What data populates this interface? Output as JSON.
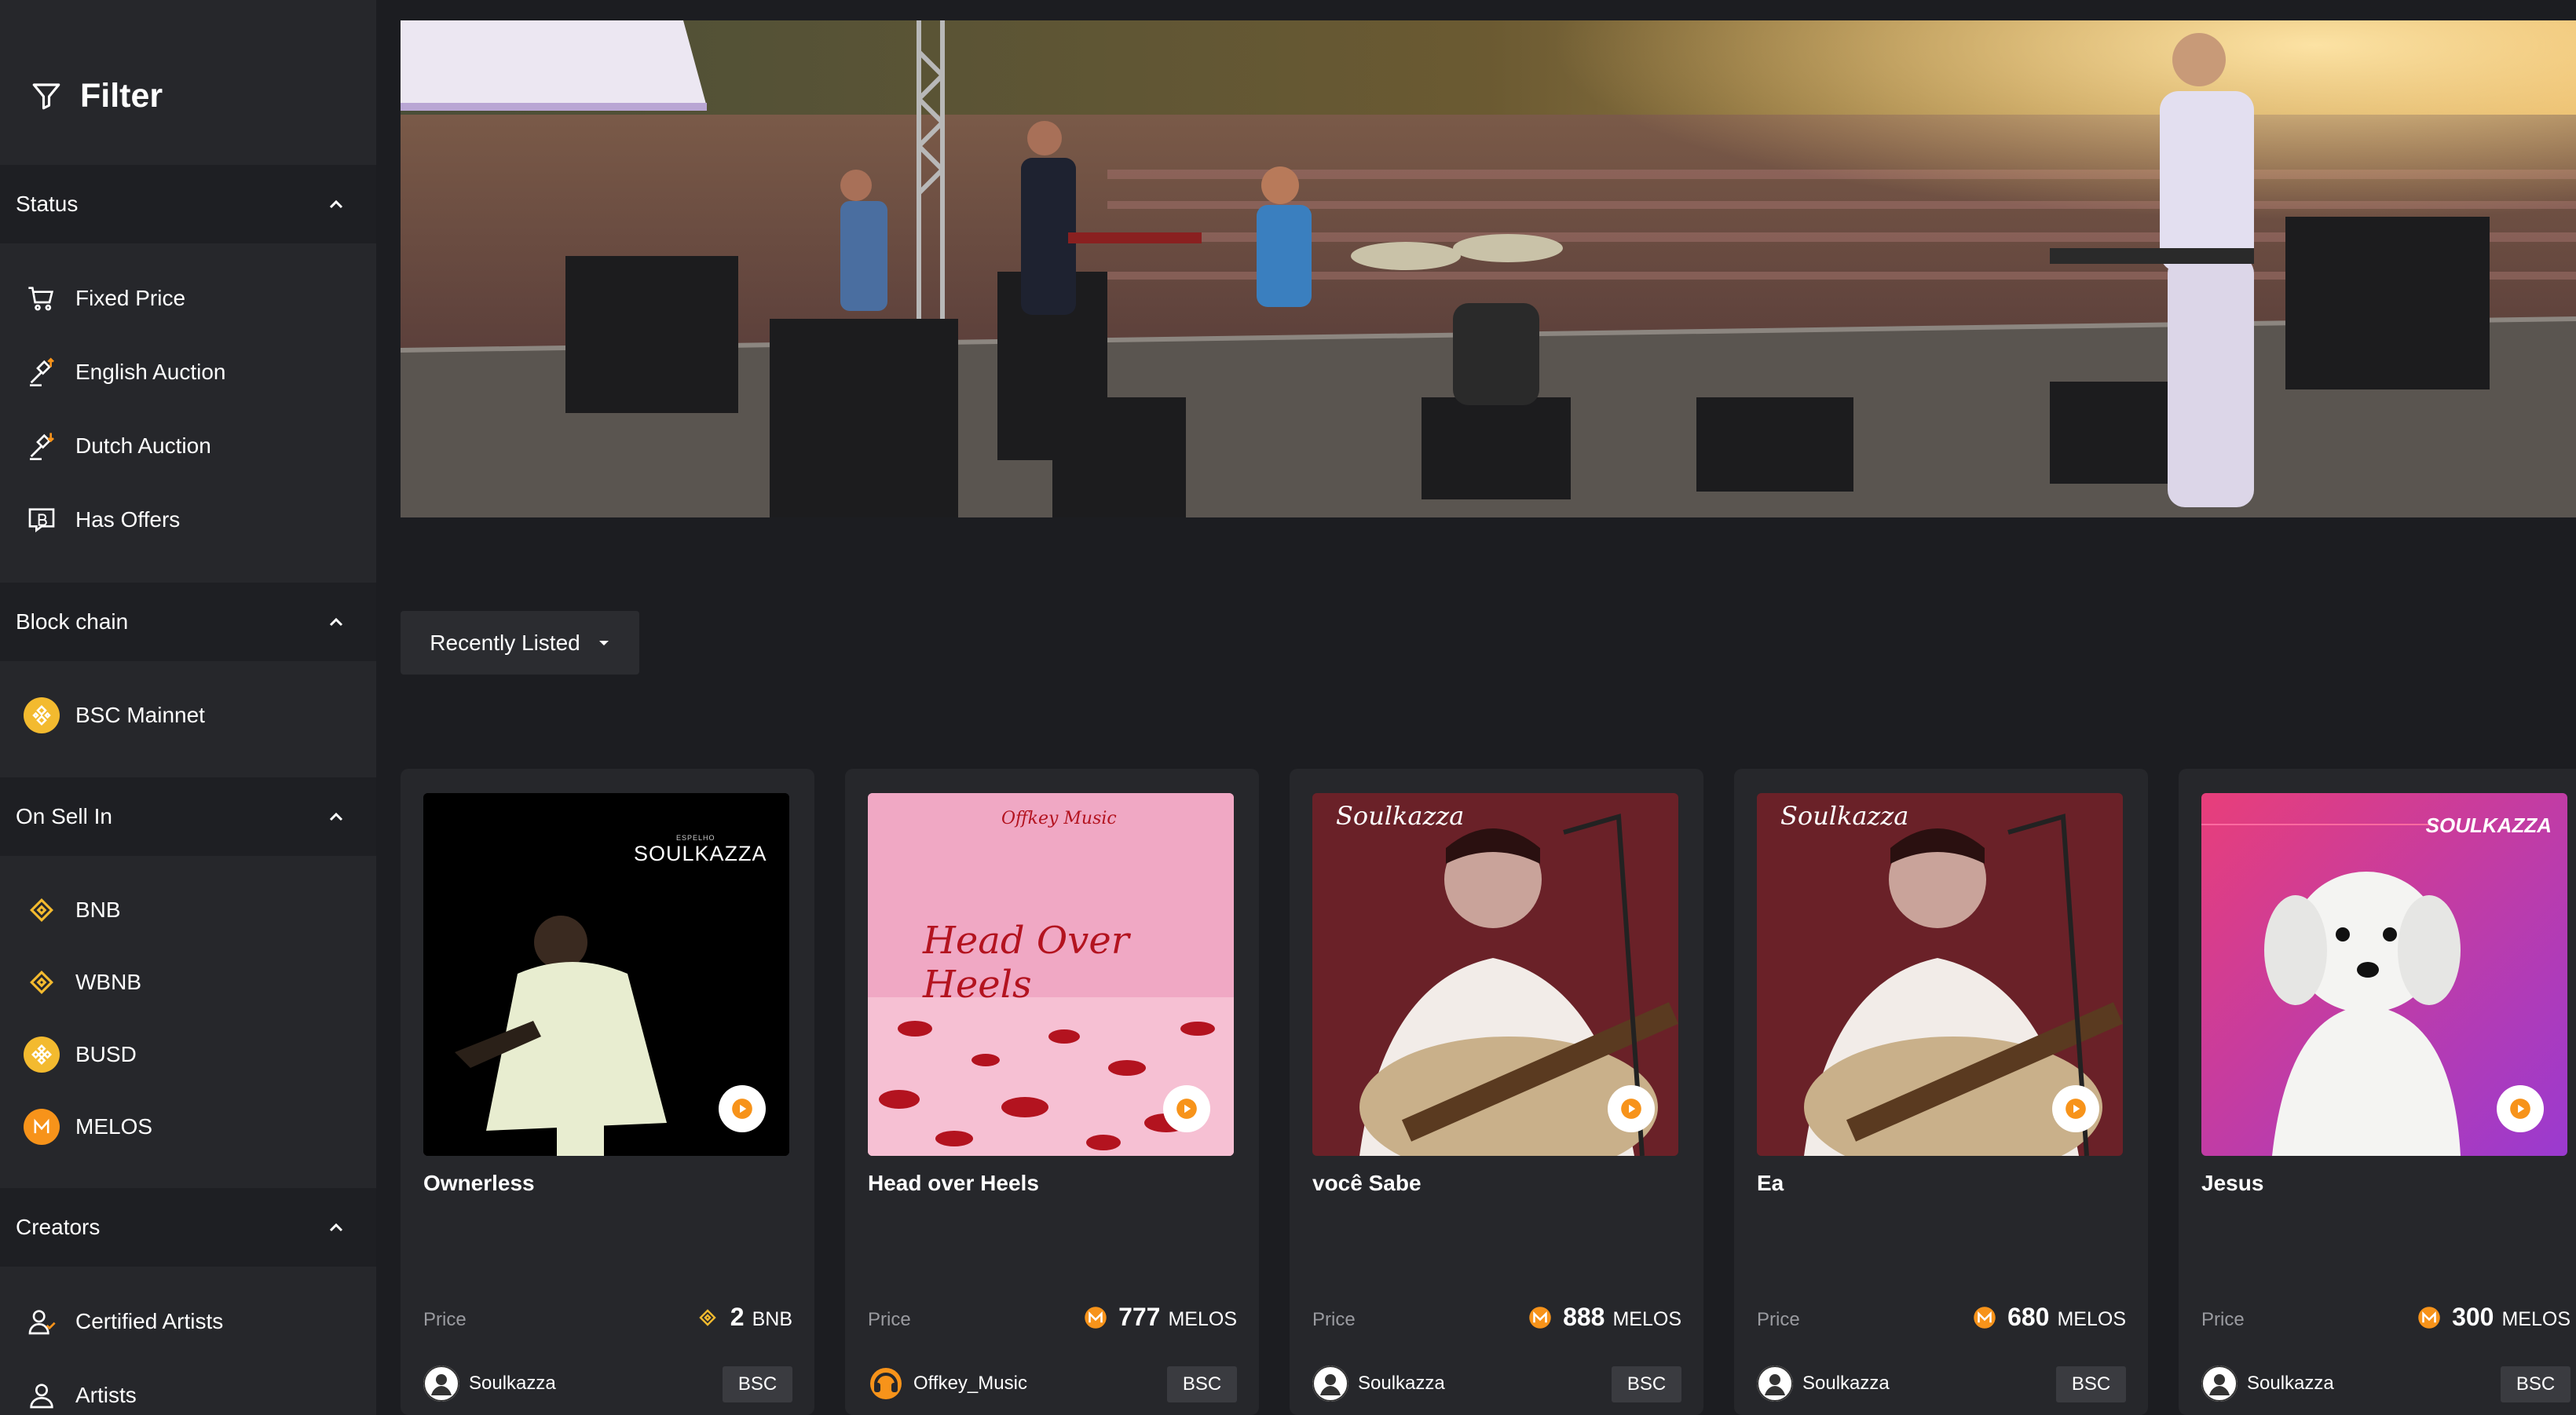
{
  "sidebar": {
    "title": "Filter",
    "sections": {
      "status": {
        "label": "Status",
        "items": [
          "Fixed Price",
          "English Auction",
          "Dutch Auction",
          "Has Offers"
        ]
      },
      "blockchain": {
        "label": "Block chain",
        "items": [
          "BSC Mainnet"
        ]
      },
      "on_sell_in": {
        "label": "On Sell In",
        "items": [
          "BNB",
          "WBNB",
          "BUSD",
          "MELOS"
        ]
      },
      "creators": {
        "label": "Creators",
        "items": [
          "Certified Artists",
          "Artists"
        ]
      }
    }
  },
  "sort": {
    "label": "Recently Listed"
  },
  "price_label": "Price",
  "cards": [
    {
      "name": "Ownerless",
      "price": "2",
      "currency": "BNB",
      "creator": "Soulkazza",
      "chain": "BSC",
      "art_text": "SOULKAZZA",
      "art_subtext": "ESPELHO"
    },
    {
      "name": "Head over Heels",
      "price": "777",
      "currency": "MELOS",
      "creator": "Offkey_Music",
      "chain": "BSC",
      "art_text": "Head Over Heels",
      "art_subtext": "Offkey Music"
    },
    {
      "name": "você Sabe",
      "price": "888",
      "currency": "MELOS",
      "creator": "Soulkazza",
      "chain": "BSC",
      "art_text": "Soulkazza"
    },
    {
      "name": "Ea",
      "price": "680",
      "currency": "MELOS",
      "creator": "Soulkazza",
      "chain": "BSC",
      "art_text": "Soulkazza"
    },
    {
      "name": "Jesus",
      "price": "300",
      "currency": "MELOS",
      "creator": "Soulkazza",
      "chain": "BSC",
      "art_text": "SOULKAZZA"
    }
  ],
  "colors": {
    "sidebar_bg": "#26272b",
    "section_bg": "#1e1f23",
    "page_bg": "#1c1d21",
    "bnb_yellow": "#f3ba2f",
    "melos_orange": "#f7931a"
  }
}
